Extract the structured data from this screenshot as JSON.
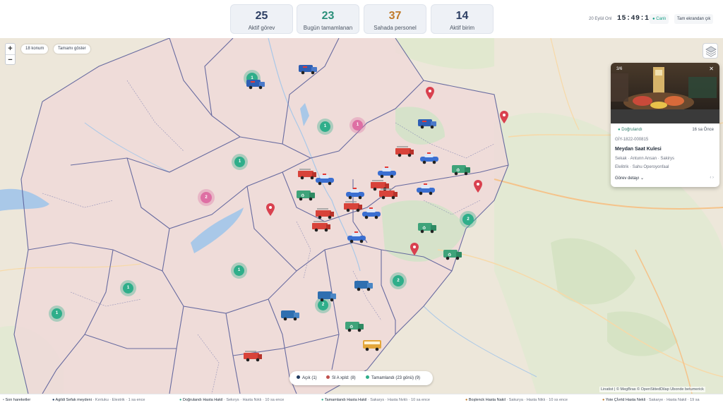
{
  "stats": [
    {
      "value": "25",
      "label": "Aktif görev",
      "color": "#2c3e63"
    },
    {
      "value": "23",
      "label": "Bugün tamamlanan",
      "color": "#2a8f7a"
    },
    {
      "value": "37",
      "label": "Sahada personel",
      "color": "#c07a2a"
    },
    {
      "value": "14",
      "label": "Aktif birim",
      "color": "#2c3e63"
    }
  ],
  "clock": {
    "date": "20 Eylül Onl",
    "time": "15:49:14",
    "live": "Canlı",
    "fullscreen": "Tam ekrandan çık"
  },
  "map": {
    "zoom_in": "+",
    "zoom_out": "−",
    "location_count": "18 konum",
    "show_all": "Tamamı göster",
    "layers_icon": "layers-icon",
    "clusters": [
      {
        "count": "1",
        "color": "green"
      },
      {
        "count": "1",
        "color": "pink"
      },
      {
        "count": "1",
        "color": "green"
      },
      {
        "count": "1",
        "color": "green"
      },
      {
        "count": "2",
        "color": "pink"
      },
      {
        "count": "2",
        "color": "green"
      },
      {
        "count": "1",
        "color": "green"
      },
      {
        "count": "1",
        "color": "green"
      },
      {
        "count": "1",
        "color": "green"
      },
      {
        "count": "2",
        "color": "green"
      },
      {
        "count": "2",
        "color": "green"
      }
    ],
    "vehicle_types": [
      "police-car",
      "fire-truck",
      "garbage-truck",
      "delivery-van",
      "bus"
    ],
    "attribution": "Linatist | © MegBras © OpenStitedDilap Ubonde betumerick"
  },
  "popup": {
    "counter": "3/6",
    "close": "✕",
    "status": "Doğrulandı",
    "ago": "16 sa Önce",
    "code": "GİY-1822-000815",
    "title": "Meydan Saat Kulesi",
    "address": "Sekak · Antunn Ansan · Sakirys",
    "department": "Elelitrik · Sahu Operoyonfaal",
    "detail": "Görev detayı",
    "nav": "‹  ›"
  },
  "legend": [
    {
      "label": "Açık (1)",
      "color": "#1f3a5f"
    },
    {
      "label": "Sl A xpld: (8)",
      "color": "#c0504d"
    },
    {
      "label": "Tamamlandı (23 gönü) (9)",
      "color": "#2fae8a"
    }
  ],
  "ticker": {
    "title": "Son hareketler",
    "items": [
      {
        "type": "Agildi",
        "place": "Sefak meydeni",
        "dist": "Kırıtuku",
        "unit": "Elestrik",
        "time": "1 sa ence",
        "color": "#1f3a5f"
      },
      {
        "type": "Doğrulandı",
        "place": "Hasta Hakil",
        "dist": "Sekırys",
        "unit": "Hasta Nıklı",
        "time": "10 sa ence",
        "color": "#2fae8a"
      },
      {
        "type": "Tamamlandı",
        "place": "Hasta Hakil",
        "dist": "Sakarys",
        "unit": "Hasta Nvklı",
        "time": "10 sa ence",
        "color": "#2fae8a"
      },
      {
        "type": "Boşlenck",
        "place": "Hasta Nakil",
        "dist": "Sakurya",
        "unit": "Hasta Niklı",
        "time": "10 ss ence",
        "color": "#c07a2a"
      },
      {
        "type": "Yoie Çİvrtd",
        "place": "Hasta Nekli",
        "dist": "Sakarye",
        "unit": "Hasta Nakil",
        "time": "19 sa",
        "color": "#c07a2a"
      }
    ]
  }
}
